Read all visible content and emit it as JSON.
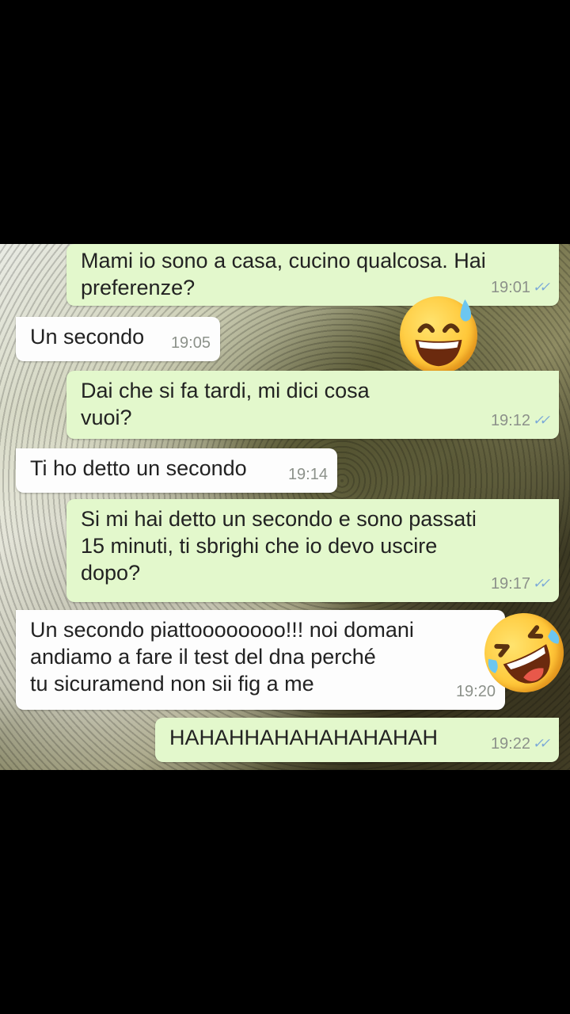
{
  "messages": [
    {
      "side": "out",
      "text": "Mami io sono a casa, cucino qualcosa. Hai\npreferenze?",
      "time": "19:01",
      "ticks": "✓✓"
    },
    {
      "side": "in",
      "text": "Un secondo",
      "time": "19:05"
    },
    {
      "side": "out",
      "text": "Dai che si fa tardi, mi dici cosa\nvuoi?",
      "time": "19:12",
      "ticks": "✓✓"
    },
    {
      "side": "in",
      "text": "Ti ho detto un secondo",
      "time": "19:14"
    },
    {
      "side": "out",
      "text": "Si mi hai detto un secondo e sono passati\n15 minuti, ti sbrighi che io devo uscire\ndopo?",
      "time": "19:17",
      "ticks": "✓✓"
    },
    {
      "side": "in",
      "text": "Un secondo piattoooooooo!!! noi domani\nandiamo a fare il test del dna perché\ntu sicuramend non sii fig a me",
      "time": "19:20"
    },
    {
      "side": "out",
      "text": "HAHAHHAHAHAHAHAHAH",
      "time": "19:22",
      "ticks": "✓✓"
    }
  ],
  "emojis": [
    "grinning-sweat-emoji",
    "rolling-laughing-emoji"
  ],
  "colors": {
    "outgoing_bubble": "#e3f8cc",
    "incoming_bubble": "#fdfdfd",
    "ticks": "#7aa8d8"
  }
}
